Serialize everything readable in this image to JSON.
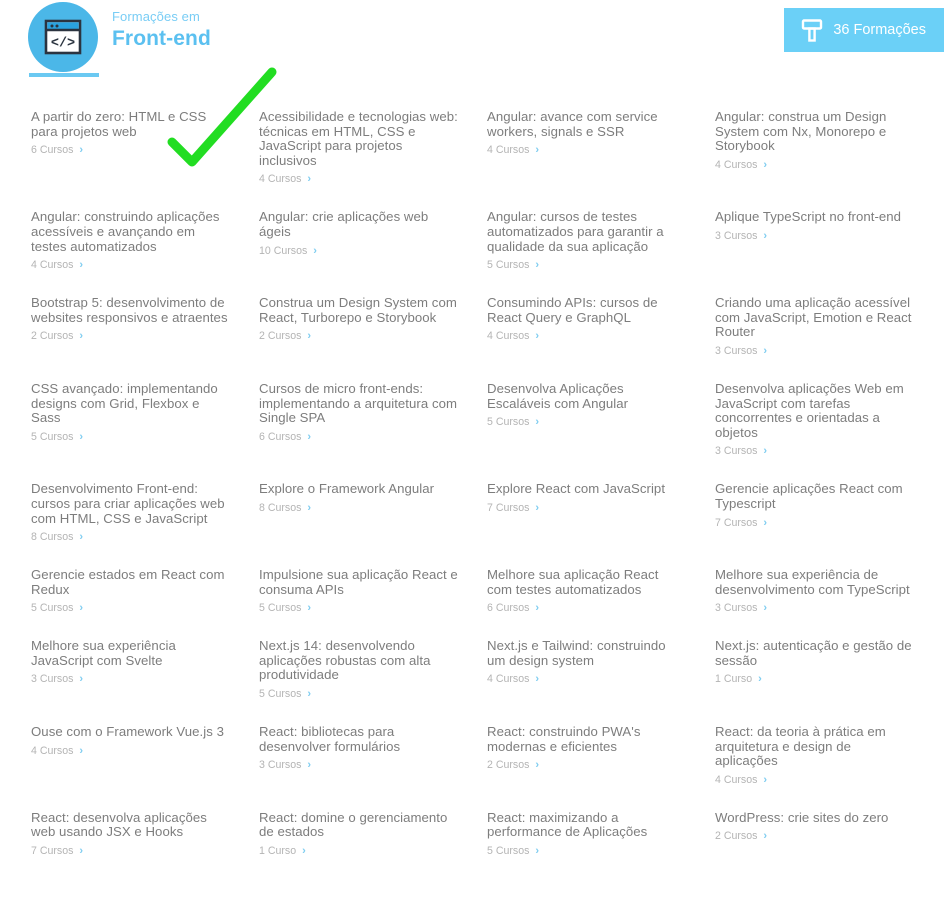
{
  "header": {
    "kicker": "Formações em",
    "title": "Front-end",
    "brand_icon": "code-window-icon",
    "colors": {
      "accent": "#5bc0f0",
      "kicker": "#79cdf5",
      "divider": "#6bc9f2",
      "badge_bg": "#6bd0f7",
      "title_text": "#7d7d7d",
      "meta_text": "#b4b4b4",
      "chevron": "#7fcdf0",
      "annotation": "#22dd22"
    }
  },
  "count_badge": {
    "icon": "signpost-icon",
    "label": "36 Formações"
  },
  "annotation": {
    "type": "green-checkmark",
    "color": "#22dd22"
  },
  "chevron_glyph": "›",
  "cards": [
    {
      "title": "A partir do zero: HTML e CSS para projetos web",
      "meta": "6 Cursos"
    },
    {
      "title": "Acessibilidade e tecnologias web: técnicas em HTML, CSS e JavaScript para projetos inclusivos",
      "meta": "4 Cursos"
    },
    {
      "title": "Angular: avance com service workers, signals e SSR",
      "meta": "4 Cursos"
    },
    {
      "title": "Angular: construa um Design System com Nx, Monorepo e Storybook",
      "meta": "4 Cursos"
    },
    {
      "title": "Angular: construindo aplicações acessíveis e avançando em testes automatizados",
      "meta": "4 Cursos"
    },
    {
      "title": "Angular: crie aplicações web ágeis",
      "meta": "10 Cursos"
    },
    {
      "title": "Angular: cursos de testes automatizados para garantir a qualidade da sua aplicação",
      "meta": "5 Cursos"
    },
    {
      "title": "Aplique TypeScript no front-end",
      "meta": "3 Cursos"
    },
    {
      "title": "Bootstrap 5: desenvolvimento de websites responsivos e atraentes",
      "meta": "2 Cursos"
    },
    {
      "title": "Construa um Design System com React, Turborepo e Storybook",
      "meta": "2 Cursos"
    },
    {
      "title": "Consumindo APIs: cursos de React Query e GraphQL",
      "meta": "4 Cursos"
    },
    {
      "title": "Criando uma aplicação acessível com JavaScript, Emotion e React Router",
      "meta": "3 Cursos"
    },
    {
      "title": "CSS avançado: implementando designs com Grid, Flexbox e Sass",
      "meta": "5 Cursos"
    },
    {
      "title": "Cursos de micro front-ends: implementando a arquitetura com Single SPA",
      "meta": "6 Cursos"
    },
    {
      "title": "Desenvolva Aplicações Escaláveis com Angular",
      "meta": "5 Cursos"
    },
    {
      "title": "Desenvolva aplicações Web em JavaScript com tarefas concorrentes e orientadas a objetos",
      "meta": "3 Cursos"
    },
    {
      "title": "Desenvolvimento Front-end: cursos para criar aplicações web com HTML, CSS e JavaScript",
      "meta": "8 Cursos"
    },
    {
      "title": "Explore o Framework Angular",
      "meta": "8 Cursos"
    },
    {
      "title": "Explore React com JavaScript",
      "meta": "7 Cursos"
    },
    {
      "title": "Gerencie aplicações React com Typescript",
      "meta": "7 Cursos"
    },
    {
      "title": "Gerencie estados em React com Redux",
      "meta": "5 Cursos"
    },
    {
      "title": "Impulsione sua aplicação React e consuma APIs",
      "meta": "5 Cursos"
    },
    {
      "title": "Melhore sua aplicação React com testes automatizados",
      "meta": "6 Cursos"
    },
    {
      "title": "Melhore sua experiência de desenvolvimento com TypeScript",
      "meta": "3 Cursos"
    },
    {
      "title": "Melhore sua experiência JavaScript com Svelte",
      "meta": "3 Cursos"
    },
    {
      "title": "Next.js 14: desenvolvendo aplicações robustas com alta produtividade",
      "meta": "5 Cursos"
    },
    {
      "title": "Next.js e Tailwind: construindo um design system",
      "meta": "4 Cursos"
    },
    {
      "title": "Next.js: autenticação e gestão de sessão",
      "meta": "1 Curso"
    },
    {
      "title": "Ouse com o Framework Vue.js 3",
      "meta": "4 Cursos"
    },
    {
      "title": "React: bibliotecas para desenvolver formulários",
      "meta": "3 Cursos"
    },
    {
      "title": "React: construindo PWA's modernas e eficientes",
      "meta": "2 Cursos"
    },
    {
      "title": "React: da teoria à prática em arquitetura e design de aplicações",
      "meta": "4 Cursos"
    },
    {
      "title": "React: desenvolva aplicações web usando JSX e Hooks",
      "meta": "7 Cursos"
    },
    {
      "title": "React: domine o gerenciamento de estados",
      "meta": "1 Curso"
    },
    {
      "title": "React: maximizando a performance de Aplicações",
      "meta": "5 Cursos"
    },
    {
      "title": "WordPress: crie sites do zero",
      "meta": "2 Cursos"
    }
  ]
}
